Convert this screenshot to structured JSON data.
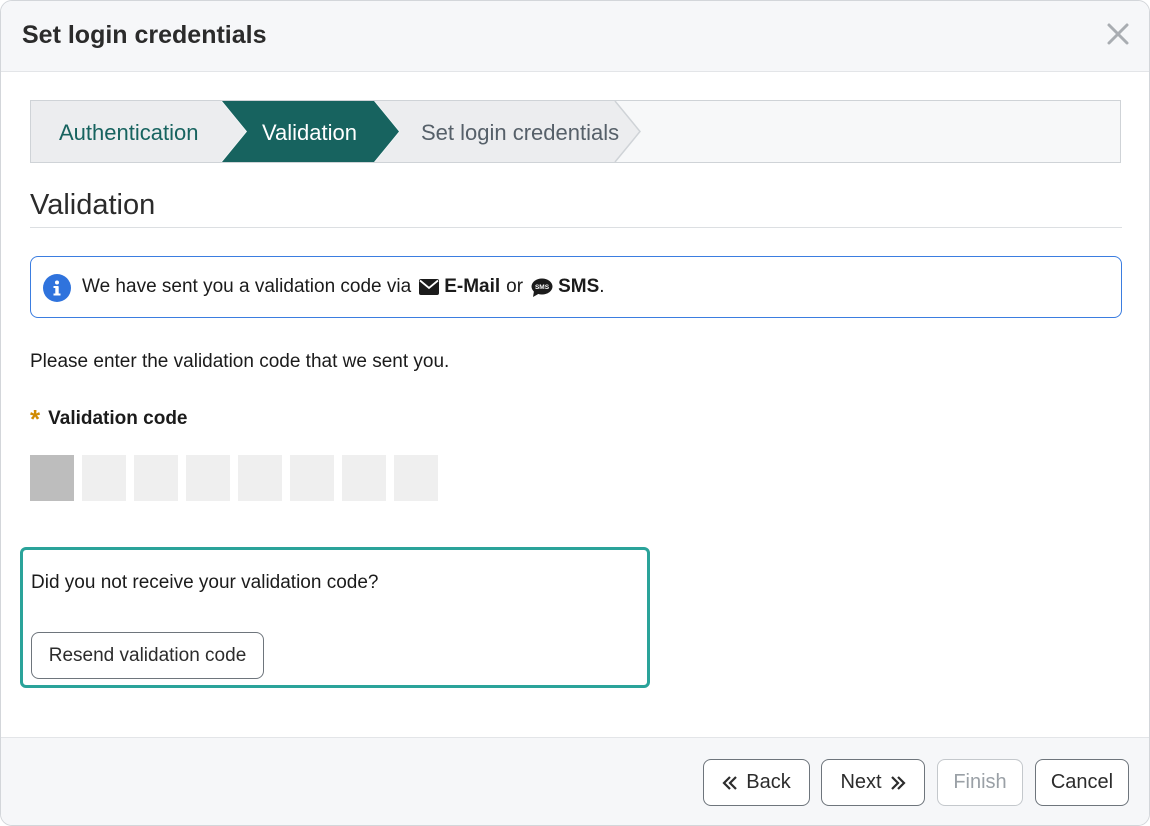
{
  "dialog": {
    "title": "Set login credentials"
  },
  "stepper": {
    "steps": [
      {
        "label": "Authentication",
        "state": "completed"
      },
      {
        "label": "Validation",
        "state": "active"
      },
      {
        "label": "Set login credentials",
        "state": "upcoming"
      }
    ]
  },
  "section": {
    "title": "Validation"
  },
  "info": {
    "text_prefix": "We have sent you a validation code via",
    "email_label": "E-Mail",
    "or_text": "or",
    "sms_label": "SMS",
    "suffix": "."
  },
  "instruction": "Please enter the validation code that we sent you.",
  "code_field": {
    "required_mark": "*",
    "label": "Validation code",
    "digits": [
      "",
      "",
      "",
      "",
      "",
      "",
      "",
      ""
    ]
  },
  "resend": {
    "question": "Did you not receive your validation code?",
    "button_label": "Resend validation code"
  },
  "footer": {
    "back_label": "Back",
    "next_label": "Next",
    "finish_label": "Finish",
    "cancel_label": "Cancel"
  },
  "colors": {
    "brand_teal": "#17635f",
    "highlight_teal": "#2aa39a",
    "info_blue": "#3b7de0",
    "required_orange": "#d08a00"
  },
  "icons": {
    "close": "close-icon",
    "info": "info-icon",
    "email": "envelope-icon",
    "sms": "sms-bubble-icon",
    "back": "double-chevron-left-icon",
    "next": "double-chevron-right-icon"
  }
}
